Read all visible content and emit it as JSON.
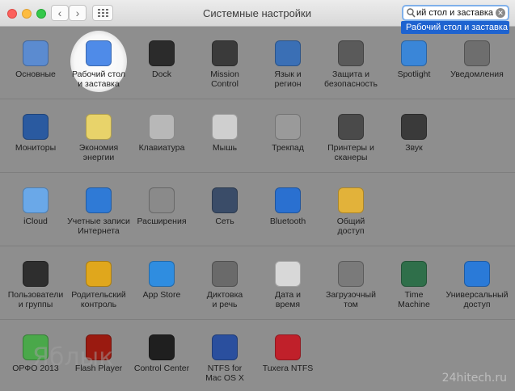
{
  "window": {
    "title": "Системные настройки"
  },
  "search": {
    "value": "ий стол и заставка",
    "suggestion": "Рабочий стол и заставка"
  },
  "rows": [
    [
      {
        "label": "Основные",
        "icon": "general-icon",
        "color": "#5b8bd0"
      },
      {
        "label": "Рабочий стол\nи заставка",
        "icon": "desktop-screensaver-icon",
        "color": "#4f8be8"
      },
      {
        "label": "Dock",
        "icon": "dock-icon",
        "color": "#2b2b2b"
      },
      {
        "label": "Mission\nControl",
        "icon": "mission-control-icon",
        "color": "#3a3a3a"
      },
      {
        "label": "Язык и\nрегион",
        "icon": "language-region-icon",
        "color": "#3a6fb5"
      },
      {
        "label": "Защита и\nбезопасность",
        "icon": "security-icon",
        "color": "#5a5a5a"
      },
      {
        "label": "Spotlight",
        "icon": "spotlight-icon",
        "color": "#3a86d8"
      },
      {
        "label": "Уведомления",
        "icon": "notifications-icon",
        "color": "#6e6e6e"
      }
    ],
    [
      {
        "label": "Мониторы",
        "icon": "displays-icon",
        "color": "#2a5aa0"
      },
      {
        "label": "Экономия\nэнергии",
        "icon": "energy-saver-icon",
        "color": "#e8d36a"
      },
      {
        "label": "Клавиатура",
        "icon": "keyboard-icon",
        "color": "#b8b8b8"
      },
      {
        "label": "Мышь",
        "icon": "mouse-icon",
        "color": "#cfcfcf"
      },
      {
        "label": "Трекпад",
        "icon": "trackpad-icon",
        "color": "#9a9a9a"
      },
      {
        "label": "Принтеры и\nсканеры",
        "icon": "printer-icon",
        "color": "#4a4a4a"
      },
      {
        "label": "Звук",
        "icon": "sound-icon",
        "color": "#3a3a3a"
      }
    ],
    [
      {
        "label": "iCloud",
        "icon": "icloud-icon",
        "color": "#6aa8e8"
      },
      {
        "label": "Учетные записи\nИнтернета",
        "icon": "internet-accounts-icon",
        "color": "#2f7ad6"
      },
      {
        "label": "Расширения",
        "icon": "extensions-icon",
        "color": "#8a8a8a"
      },
      {
        "label": "Сеть",
        "icon": "network-icon",
        "color": "#3a4c68"
      },
      {
        "label": "Bluetooth",
        "icon": "bluetooth-icon",
        "color": "#2a70d0"
      },
      {
        "label": "Общий\nдоступ",
        "icon": "sharing-icon",
        "color": "#e2b23a"
      }
    ],
    [
      {
        "label": "Пользователи\nи группы",
        "icon": "users-groups-icon",
        "color": "#2e2e2e"
      },
      {
        "label": "Родительский\nконтроль",
        "icon": "parental-controls-icon",
        "color": "#e0a71c"
      },
      {
        "label": "App Store",
        "icon": "app-store-icon",
        "color": "#2f8de0"
      },
      {
        "label": "Диктовка\nи речь",
        "icon": "dictation-icon",
        "color": "#6a6a6a"
      },
      {
        "label": "Дата и\nвремя",
        "icon": "date-time-icon",
        "color": "#d8d8d8"
      },
      {
        "label": "Загрузочный\nтом",
        "icon": "startup-disk-icon",
        "color": "#7a7a7a"
      },
      {
        "label": "Time\nMachine",
        "icon": "time-machine-icon",
        "color": "#2f6f4a"
      },
      {
        "label": "Универсальный\nдоступ",
        "icon": "accessibility-icon",
        "color": "#2a7ad8"
      }
    ],
    [
      {
        "label": "ОРФО 2013",
        "icon": "orfo-icon",
        "color": "#4aa84a"
      },
      {
        "label": "Flash Player",
        "icon": "flash-player-icon",
        "color": "#9a1a10"
      },
      {
        "label": "Control Center",
        "icon": "logitech-icon",
        "color": "#1f1f1f"
      },
      {
        "label": "NTFS for\nMac OS X",
        "icon": "ntfs-icon",
        "color": "#2a4f9e"
      },
      {
        "label": "Tuxera NTFS",
        "icon": "tuxera-icon",
        "color": "#c0202a"
      }
    ]
  ],
  "watermark": "24hitech.ru",
  "watermark_left": "Яблык"
}
